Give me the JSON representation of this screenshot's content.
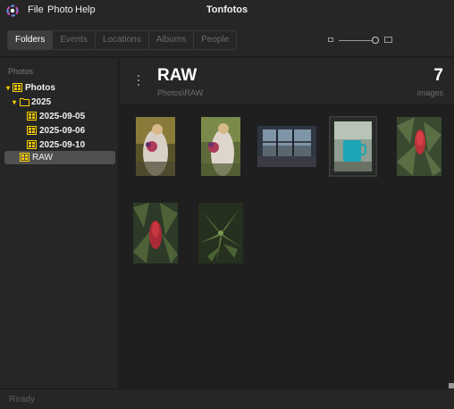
{
  "titlebar": {
    "app_title": "Tonfotos",
    "menu": [
      "File",
      "Photo",
      "Help"
    ]
  },
  "toolbar": {
    "tabs": [
      {
        "label": "Folders",
        "active": true
      },
      {
        "label": "Events",
        "active": false
      },
      {
        "label": "Locations",
        "active": false
      },
      {
        "label": "Albums",
        "active": false
      },
      {
        "label": "People",
        "active": false
      }
    ],
    "zoom_icons": [
      "small-image-icon",
      "large-image-icon"
    ]
  },
  "sidebar": {
    "header": "Photos",
    "tree": [
      {
        "label": "Photos",
        "icon": "photos-grid-icon",
        "expanded": true
      },
      {
        "label": "2025",
        "icon": "folder-icon",
        "expanded": true
      },
      {
        "label": "2025-09-05",
        "icon": "photos-grid-icon"
      },
      {
        "label": "2025-09-06",
        "icon": "photos-grid-icon"
      },
      {
        "label": "2025-09-10",
        "icon": "photos-grid-icon"
      },
      {
        "label": "RAW",
        "icon": "photos-grid-icon",
        "selected": true
      }
    ]
  },
  "main": {
    "folder_title": "RAW",
    "folder_path": "Photos\\RAW",
    "count": "7",
    "count_label": "images",
    "thumbnails": [
      {
        "name": "girl-with-bouquet-1"
      },
      {
        "name": "girl-with-bouquet-2"
      },
      {
        "name": "window-view"
      },
      {
        "name": "teal-mug",
        "selected": true
      },
      {
        "name": "red-flower-bush-1"
      },
      {
        "name": "red-flower-bush-2"
      },
      {
        "name": "green-plant"
      }
    ]
  },
  "statusbar": {
    "text": "Ready"
  },
  "colors": {
    "accent_yellow": "#ffd200",
    "background": "#1f1f1f",
    "panel": "#262626",
    "selected_row": "#505050"
  }
}
